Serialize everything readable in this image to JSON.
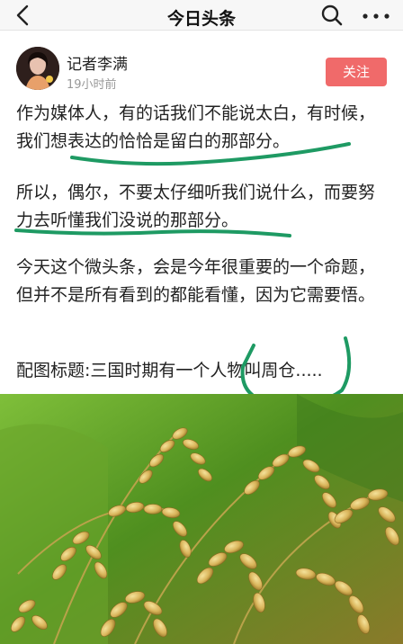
{
  "nav": {
    "title": "今日头条",
    "back_icon": "back-arrow-icon",
    "search_icon": "search-icon",
    "more_icon": "more-dots-icon"
  },
  "post": {
    "author": "记者李满",
    "time": "19小时前",
    "follow_label": "关注",
    "paragraphs": [
      "作为媒体人，有的话我们不能说太白，有时候，我们想表达的恰恰是留白的那部分。",
      "所以，偶尔，不要太仔细听我们说什么，而要努力去听懂我们没说的那部分。",
      "今天这个微头条，会是今年很重要的一个命题，但并不是所有看到的都能看懂，因为它需要悟。",
      "配图标题:三国时期有一个人物叫周仓....."
    ]
  },
  "colors": {
    "accent": "#f06a6a",
    "marker": "#1e9a63"
  }
}
